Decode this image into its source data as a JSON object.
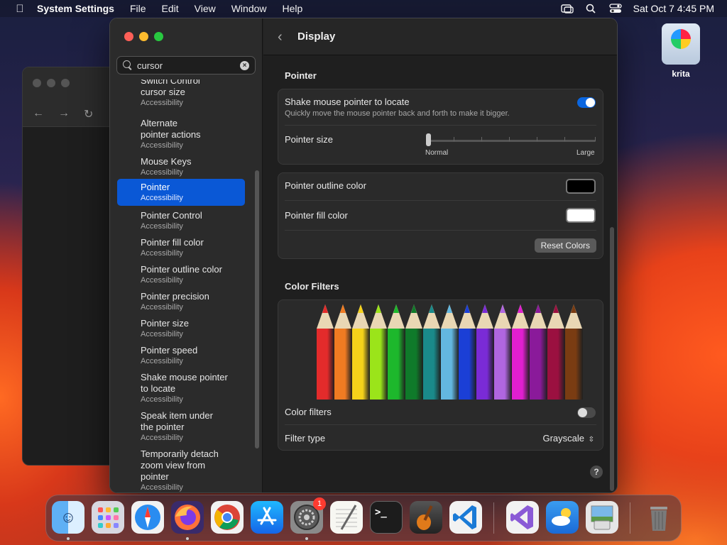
{
  "menubar": {
    "app_name": "System Settings",
    "items": [
      "File",
      "Edit",
      "View",
      "Window",
      "Help"
    ],
    "datetime": "Sat Oct 7  4:45 PM"
  },
  "sidebar": {
    "search_value": "cursor",
    "results": [
      {
        "title": "Switch Control",
        "title2": "cursor size",
        "subtitle": "Accessibility"
      },
      {
        "title": "Alternate",
        "title2": "pointer actions",
        "subtitle": "Accessibility"
      },
      {
        "title": "Mouse Keys",
        "subtitle": "Accessibility"
      },
      {
        "title": "Pointer",
        "subtitle": "Accessibility",
        "selected": true
      },
      {
        "title": "Pointer Control",
        "subtitle": "Accessibility"
      },
      {
        "title": "Pointer fill color",
        "subtitle": "Accessibility"
      },
      {
        "title": "Pointer outline color",
        "subtitle": "Accessibility"
      },
      {
        "title": "Pointer precision",
        "subtitle": "Accessibility"
      },
      {
        "title": "Pointer size",
        "subtitle": "Accessibility"
      },
      {
        "title": "Pointer speed",
        "subtitle": "Accessibility"
      },
      {
        "title": "Shake mouse pointer",
        "title2": "to locate",
        "subtitle": "Accessibility"
      },
      {
        "title": "Speak item under",
        "title2": "the pointer",
        "subtitle": "Accessibility"
      },
      {
        "title": "Temporarily detach",
        "title2": "zoom view from",
        "title3": "pointer",
        "subtitle": "Accessibility"
      }
    ]
  },
  "content": {
    "title": "Display",
    "pointer_section": "Pointer",
    "shake": {
      "label": "Shake mouse pointer to locate",
      "desc": "Quickly move the mouse pointer back and forth to make it bigger.",
      "enabled": true
    },
    "pointer_size": {
      "label": "Pointer size",
      "min_label": "Normal",
      "max_label": "Large",
      "value": 0
    },
    "outline_color": {
      "label": "Pointer outline color",
      "color": "#000000"
    },
    "fill_color": {
      "label": "Pointer fill color",
      "color": "#ffffff"
    },
    "reset_button": "Reset Colors",
    "color_filters_section": "Color Filters",
    "color_filters_toggle": {
      "label": "Color filters",
      "enabled": false
    },
    "filter_type": {
      "label": "Filter type",
      "value": "Grayscale"
    },
    "pencil_colors": [
      "#e32b2b",
      "#f07b22",
      "#f5d21a",
      "#9be41a",
      "#1db82c",
      "#0f7a2a",
      "#1a8a8a",
      "#63b7e0",
      "#1b3fd6",
      "#7a2bd6",
      "#b066e0",
      "#e01fd0",
      "#8a1a9a",
      "#9b1040",
      "#7a3c12"
    ],
    "help": "?"
  },
  "desktop": {
    "icon_label": "krita"
  },
  "dock": {
    "apps": [
      "finder",
      "launchpad",
      "safari",
      "firefox",
      "chrome",
      "app-store",
      "system-settings",
      "textedit",
      "terminal",
      "garageband",
      "vscode",
      "visual-studio",
      "weather",
      "preview",
      "trash"
    ],
    "settings_badge": "1"
  }
}
